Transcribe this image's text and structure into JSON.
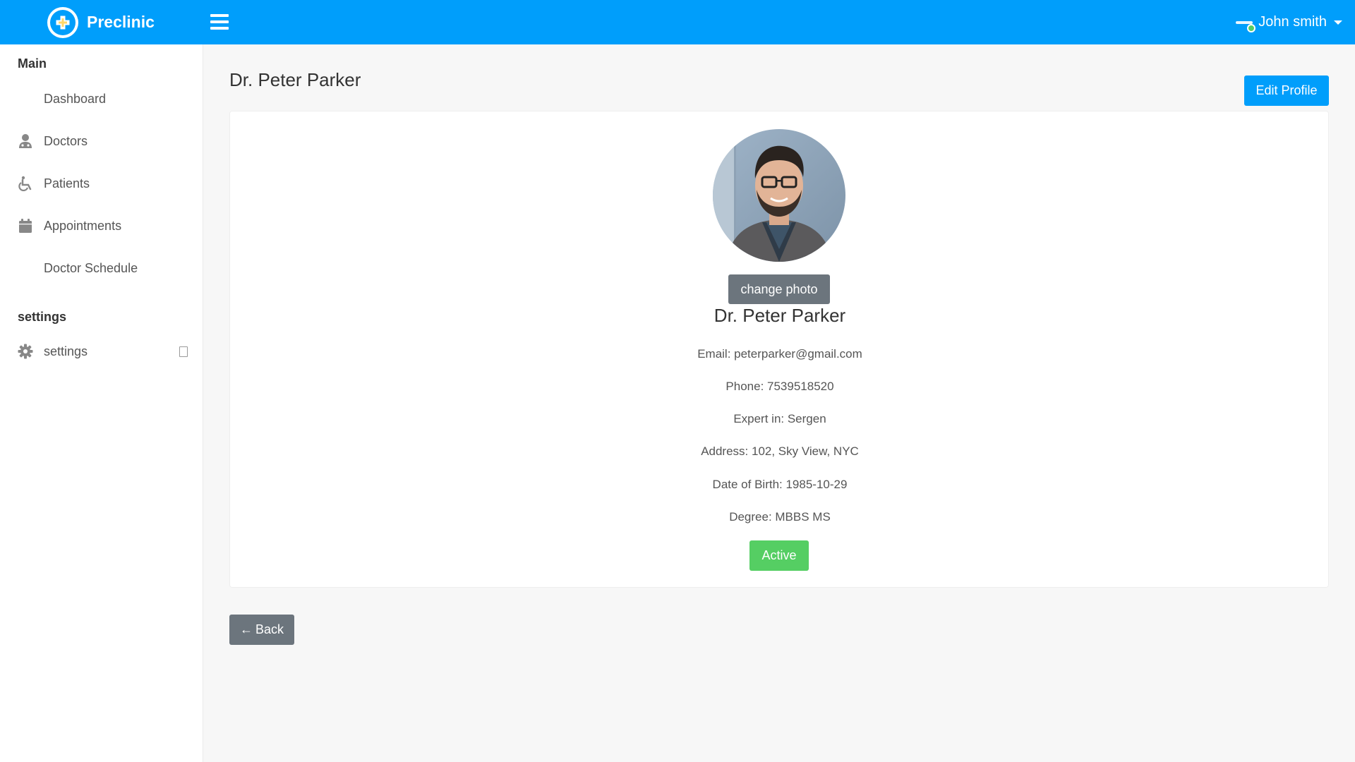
{
  "header": {
    "brand": "Preclinic",
    "brand_icon": "plus-cross-icon",
    "menu_toggle_icon": "hamburger-icon",
    "user_name": "John smith",
    "user_status_color": "#55ce63",
    "accent_color": "#009efb"
  },
  "sidebar": {
    "section_main": "Main",
    "items": [
      {
        "label": "Dashboard",
        "icon": "none"
      },
      {
        "label": "Doctors",
        "icon": "doctor-icon"
      },
      {
        "label": "Patients",
        "icon": "wheelchair-icon"
      },
      {
        "label": "Appointments",
        "icon": "calendar-icon"
      },
      {
        "label": "Doctor Schedule",
        "icon": "none"
      }
    ],
    "section_settings": "settings",
    "settings_item": {
      "label": "settings",
      "icon": "gear-icon"
    }
  },
  "main": {
    "page_title": "Dr. Peter Parker",
    "edit_profile_label": "Edit Profile",
    "change_photo_label": "change photo",
    "profile_name": "Dr. Peter Parker",
    "email": "Email: peterparker@gmail.com",
    "phone": "Phone: 7539518520",
    "expert": "Expert in: Sergen",
    "address": "Address: 102, Sky View, NYC",
    "dob": "Date of Birth: 1985-10-29",
    "degree": "Degree: MBBS MS",
    "status": "Active",
    "back_label": "Back"
  }
}
